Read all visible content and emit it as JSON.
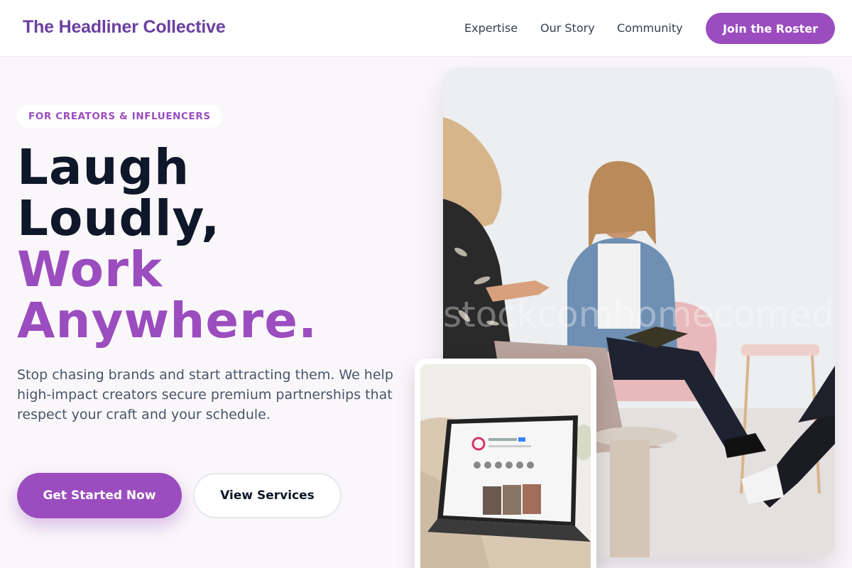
{
  "header": {
    "brand": "The Headliner Collective",
    "nav": [
      "Expertise",
      "Our Story",
      "Community"
    ],
    "cta": "Join the Roster"
  },
  "hero": {
    "badge": "FOR CREATORS & INFLUENCERS",
    "headline_dark": [
      "Laugh",
      "Loudly,"
    ],
    "headline_accent": [
      "Work",
      "Anywhere."
    ],
    "subtext": "Stop chasing brands and start attracting them. We help high-impact creators secure premium partnerships that respect your craft and your schedule.",
    "primary_button": "Get Started Now",
    "secondary_button": "View Services"
  },
  "images": {
    "main_photo": "people-talking-with-laptop-photo",
    "secondary_photo": "laptop-on-bed-photo",
    "watermark": "stockcomhomecomedy.c"
  },
  "colors": {
    "accent": "#9b4dbf",
    "brand": "#6b3fa0",
    "heading": "#0f172a",
    "body": "#475569"
  }
}
